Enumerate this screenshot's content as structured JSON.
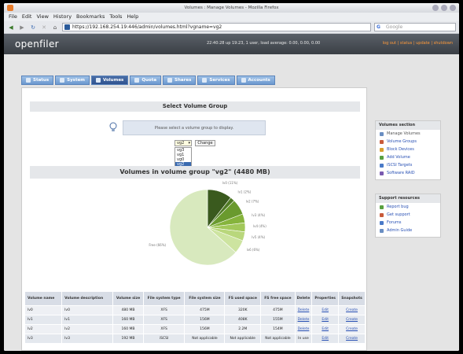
{
  "window": {
    "title": "Volumes : Manage Volumes - Mozilla Firefox"
  },
  "menu": [
    "File",
    "Edit",
    "View",
    "History",
    "Bookmarks",
    "Tools",
    "Help"
  ],
  "url": "https://192.168.254.19:446/admin/volumes.html?vgname=vg2",
  "search_placeholder": "Google",
  "header": {
    "logo": "openfiler",
    "status_line": "22:40:28 up 19:23, 1 user, load average: 0.00, 0.00, 0.00",
    "links": "log out | status | update | shutdown"
  },
  "tabs": [
    "Status",
    "System",
    "Volumes",
    "Quota",
    "Shares",
    "Services",
    "Accounts"
  ],
  "select_vg": {
    "heading": "Select Volume Group",
    "info": "Please select a volume group to display.",
    "selected": "vg2",
    "options": [
      "vg3",
      "vg1",
      "vg0",
      "vg2"
    ],
    "change_label": "Change"
  },
  "volumes_heading": "Volumes in volume group \"vg2\" (4480 MB)",
  "pie_labels": [
    "lv0 (11%)",
    "lv1 (2%)",
    "lv2 (7%)",
    "lv3 (4%)",
    "lv4 (4%)",
    "lv5 (4%)",
    "lv6 (6%)",
    "Free (66%)"
  ],
  "chart_data": {
    "type": "pie",
    "labels": [
      "lv0",
      "lv1",
      "lv2",
      "lv3",
      "lv4",
      "lv5",
      "lv6",
      "Free"
    ],
    "values": [
      11,
      2,
      7,
      4,
      4,
      4,
      6,
      66
    ],
    "colors": [
      "#3a5a1e",
      "#4f7a25",
      "#6a9a2e",
      "#86b43c",
      "#a2c85a",
      "#b9d77c",
      "#cde4a0",
      "#d8e9be"
    ]
  },
  "table": {
    "headers": [
      "Volume name",
      "Volume description",
      "Volume size",
      "File system type",
      "File system size",
      "FS used space",
      "FS free space",
      "Delete",
      "Properties",
      "Snapshots"
    ],
    "rows": [
      [
        "lv0",
        "lv0",
        "480 MB",
        "XFS",
        "475M",
        "320K",
        "475M",
        "Delete",
        "Edit",
        "Create"
      ],
      [
        "lv1",
        "lv1",
        "160 MB",
        "XFS",
        "156M",
        "408K",
        "155M",
        "Delete",
        "Edit",
        "Create"
      ],
      [
        "lv2",
        "lv2",
        "160 MB",
        "XFS",
        "156M",
        "2.2M",
        "154M",
        "Delete",
        "Edit",
        "Create"
      ],
      [
        "lv3",
        "lv3",
        "192 MB",
        "iSCSI",
        "Not applicable",
        "Not applicable",
        "Not applicable",
        "In use",
        "Edit",
        "Create"
      ]
    ]
  },
  "volumes_section": {
    "title": "Volumes section",
    "items": [
      "Manage Volumes",
      "Volume Groups",
      "Block Devices",
      "Add Volume",
      "iSCSI Targets",
      "Software RAID"
    ]
  },
  "support_section": {
    "title": "Support resources",
    "items": [
      "Report bug",
      "Get support",
      "Forums",
      "Admin Guide"
    ]
  }
}
